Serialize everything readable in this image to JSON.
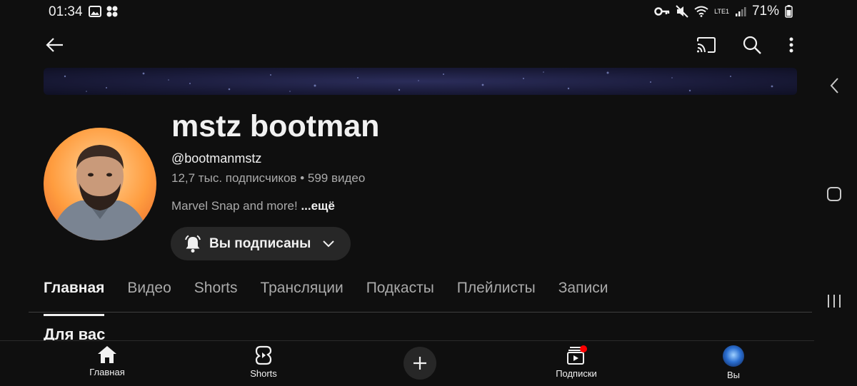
{
  "status_bar": {
    "time": "01:34",
    "battery": "71%",
    "network": "LTE1"
  },
  "top_bar": {
    "back_icon": "arrow-left-icon",
    "cast_icon": "cast-icon",
    "search_icon": "search-icon",
    "menu_icon": "more-vert-icon"
  },
  "channel": {
    "name": "mstz bootman",
    "handle": "@bootmanmstz",
    "subscribers": "12,7 тыс. подписчиков",
    "separator": "•",
    "videos": "599 видео",
    "description": "Marvel Snap and more!",
    "more_label": "...ещё",
    "subscribe_label": "Вы подписаны"
  },
  "tabs": [
    {
      "label": "Главная",
      "active": true
    },
    {
      "label": "Видео",
      "active": false
    },
    {
      "label": "Shorts",
      "active": false
    },
    {
      "label": "Трансляции",
      "active": false
    },
    {
      "label": "Подкасты",
      "active": false
    },
    {
      "label": "Плейлисты",
      "active": false
    },
    {
      "label": "Записи",
      "active": false
    }
  ],
  "section": {
    "title": "Для вас"
  },
  "bottom_nav": {
    "home_label": "Главная",
    "shorts_label": "Shorts",
    "subscriptions_label": "Подписки",
    "you_label": "Вы",
    "subscriptions_badge_color": "#ff0000"
  },
  "colors": {
    "background": "#0f0f0f",
    "chip": "#272727",
    "secondary_text": "#aaaaaa"
  }
}
